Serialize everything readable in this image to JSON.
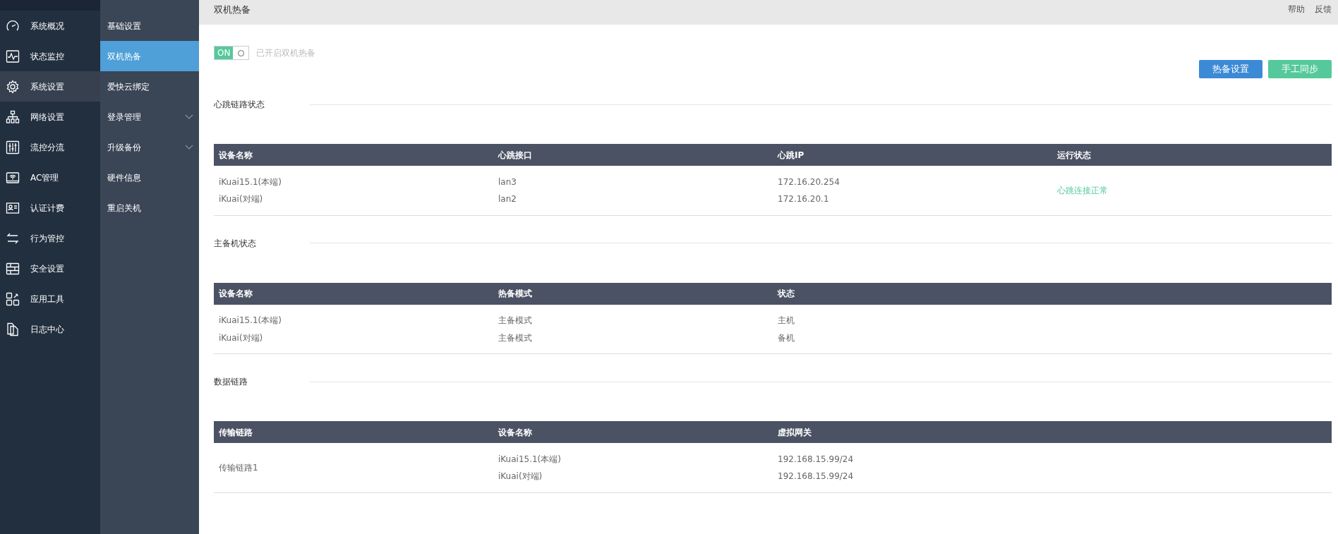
{
  "sidebar": {
    "items": [
      {
        "label": "系统概况",
        "selected": false
      },
      {
        "label": "状态监控",
        "selected": false
      },
      {
        "label": "系统设置",
        "selected": true
      },
      {
        "label": "网络设置",
        "selected": false
      },
      {
        "label": "流控分流",
        "selected": false
      },
      {
        "label": "AC管理",
        "selected": false
      },
      {
        "label": "认证计费",
        "selected": false
      },
      {
        "label": "行为管控",
        "selected": false
      },
      {
        "label": "安全设置",
        "selected": false
      },
      {
        "label": "应用工具",
        "selected": false
      },
      {
        "label": "日志中心",
        "selected": false
      }
    ]
  },
  "submenu": {
    "items": [
      {
        "label": "基础设置",
        "selected": false,
        "has_children": false
      },
      {
        "label": "双机热备",
        "selected": true,
        "has_children": false
      },
      {
        "label": "爱快云绑定",
        "selected": false,
        "has_children": false
      },
      {
        "label": "登录管理",
        "selected": false,
        "has_children": true
      },
      {
        "label": "升级备份",
        "selected": false,
        "has_children": true
      },
      {
        "label": "硬件信息",
        "selected": false,
        "has_children": false
      },
      {
        "label": "重启关机",
        "selected": false,
        "has_children": false
      }
    ]
  },
  "header": {
    "title": "双机热备",
    "links": [
      "帮助",
      "反馈"
    ]
  },
  "toggle": {
    "label": "ON",
    "on": true,
    "caption": "已开启双机热备"
  },
  "buttons": [
    {
      "label": "热备设置",
      "kind": "primary"
    },
    {
      "label": "手工同步",
      "kind": "success"
    }
  ],
  "sections": [
    {
      "title": "心跳链路状态",
      "table": {
        "columns": [
          {
            "label": "设备名称"
          },
          {
            "label": "心跳接口"
          },
          {
            "label": "心跳IP"
          },
          {
            "label": "运行状态"
          }
        ],
        "rows": [
          [
            "iKuai15.1(本端)",
            "lan3",
            "172.16.20.254",
            {
              "text": "心跳连接正常",
              "rowspan": 2,
              "color": "#55c99b"
            }
          ],
          [
            "iKuai(对端)",
            "lan2",
            "172.16.20.1"
          ]
        ]
      }
    },
    {
      "title": "主备机状态",
      "table": {
        "columns": [
          {
            "label": "设备名称"
          },
          {
            "label": "热备模式"
          },
          {
            "label": "状态"
          }
        ],
        "rows": [
          [
            "iKuai15.1(本端)",
            "主备模式",
            "主机"
          ],
          [
            "iKuai(对端)",
            "主备模式",
            "备机"
          ]
        ]
      }
    },
    {
      "title": "数据链路",
      "table": {
        "columns": [
          {
            "label": "传输链路"
          },
          {
            "label": "设备名称"
          },
          {
            "label": "虚拟网关"
          }
        ],
        "rows": [
          [
            {
              "text": "传输链路1",
              "rowspan": 2
            },
            "iKuai15.1(本端)",
            "192.168.15.99/24"
          ],
          [
            "iKuai(对端)",
            "192.168.15.99/24"
          ]
        ]
      }
    }
  ]
}
